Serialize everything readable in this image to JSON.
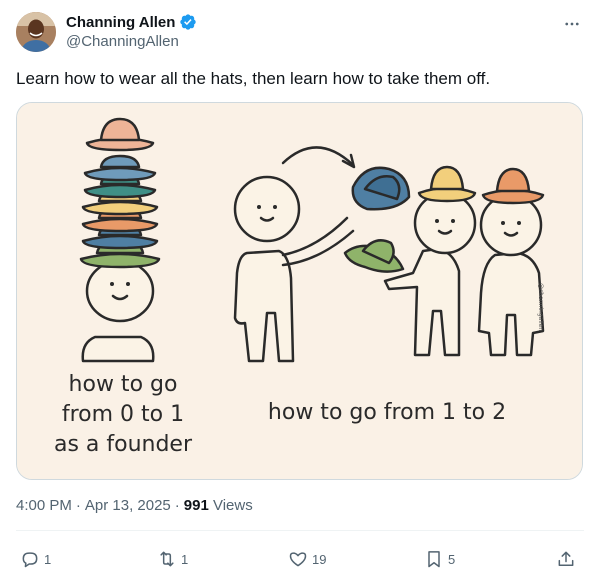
{
  "author": {
    "display_name": "Channing Allen",
    "handle": "@ChanningAllen",
    "verified": true,
    "verified_color": "#1d9bf0"
  },
  "tweet": {
    "text": "Learn how to wear all the hats, then learn how to take them off."
  },
  "media": {
    "caption_left": [
      "how to go",
      "from 0 to 1",
      "as a founder"
    ],
    "caption_right": "how to go from 1 to 2",
    "watermark": "@channingallen"
  },
  "meta": {
    "time": "4:00 PM",
    "date": "Apr 13, 2025",
    "separator": "·",
    "views_count": "991",
    "views_label": "Views"
  },
  "actions": {
    "reply": "1",
    "repost": "1",
    "like": "19",
    "bookmark": "5"
  },
  "icons": {
    "more": "more-horizontal-icon",
    "reply": "reply-bubble-icon",
    "repost": "repost-arrows-icon",
    "like": "heart-icon",
    "bookmark": "bookmark-icon",
    "share": "share-upload-icon"
  },
  "colors": {
    "text_primary": "#0f1419",
    "text_secondary": "#536471",
    "border": "#cfd9de",
    "image_background": "#faf1e6"
  }
}
